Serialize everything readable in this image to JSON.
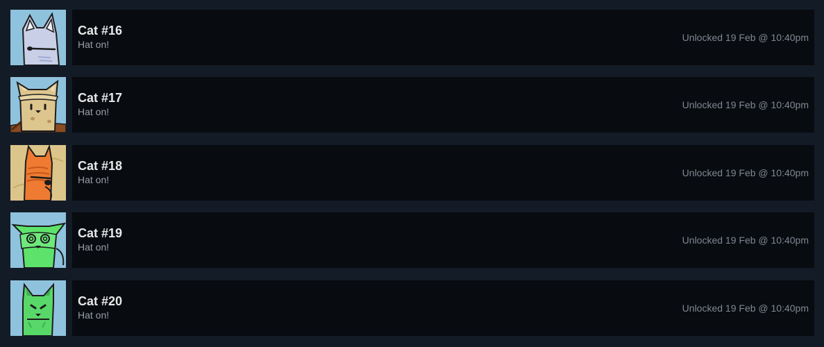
{
  "achievements": [
    {
      "title": "Cat #16",
      "description": "Hat on!",
      "unlock_time": "Unlocked 19 Feb @ 10:40pm",
      "icon": "gray-cat-icon",
      "bg_color": "#8fc2dd",
      "cat_color": "#c9cfe6"
    },
    {
      "title": "Cat #17",
      "description": "Hat on!",
      "unlock_time": "Unlocked 19 Feb @ 10:40pm",
      "icon": "tan-cat-icon",
      "bg_color": "#8fc2dd",
      "cat_color": "#ddc58e"
    },
    {
      "title": "Cat #18",
      "description": "Hat on!",
      "unlock_time": "Unlocked 19 Feb @ 10:40pm",
      "icon": "orange-cat-icon",
      "bg_color": "#dcc58a",
      "cat_color": "#ee7b31"
    },
    {
      "title": "Cat #19",
      "description": "Hat on!",
      "unlock_time": "Unlocked 19 Feb @ 10:40pm",
      "icon": "green-cat-icon",
      "bg_color": "#8fc2dd",
      "cat_color": "#5de36b"
    },
    {
      "title": "Cat #20",
      "description": "Hat on!",
      "unlock_time": "Unlocked 19 Feb @ 10:40pm",
      "icon": "green-cat-icon",
      "bg_color": "#8fc2dd",
      "cat_color": "#59d86a"
    }
  ]
}
